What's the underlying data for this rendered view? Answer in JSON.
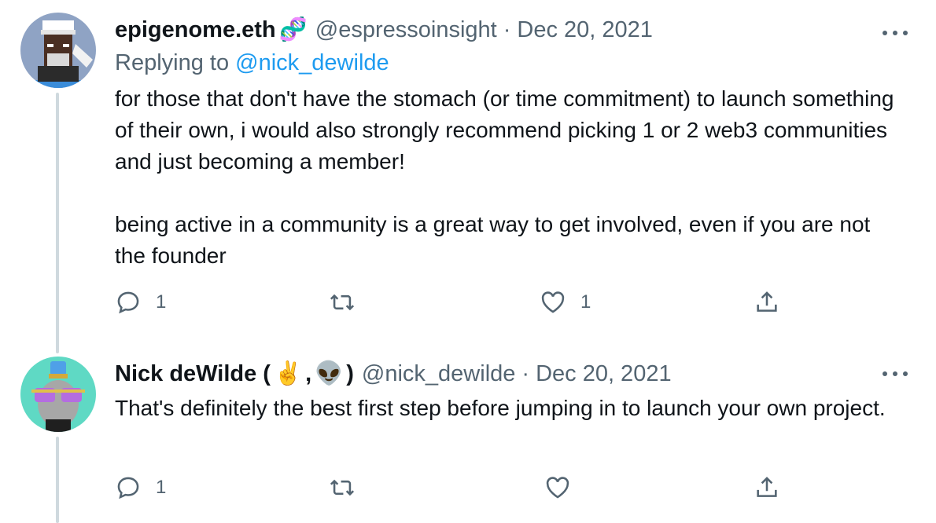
{
  "tweets": [
    {
      "author_name": "epigenome.eth",
      "author_emoji": "🧬",
      "handle": "@espressoinsight",
      "separator": "·",
      "date": "Dec 20, 2021",
      "replying_prefix": "Replying to",
      "replying_mention": "@nick_dewilde",
      "text": "for those that don't have the stomach (or time commitment) to launch something of their own, i would also strongly recommend picking 1 or 2 web3 communities and just becoming a member!\n\nbeing active in a community is a great way to get involved, even if you are not the founder",
      "replies": "1",
      "retweets": "",
      "likes": "1"
    },
    {
      "author_name_prefix": "Nick deWilde (",
      "author_emoji_1": "✌️",
      "author_name_mid": ",",
      "author_emoji_2": "👽",
      "author_name_suffix": ")",
      "handle": "@nick_dewilde",
      "separator": "·",
      "date": "Dec 20, 2021",
      "text": "That's definitely the best first step before jumping in to launch your own project.",
      "replies": "1",
      "retweets": "",
      "likes": ""
    }
  ],
  "colors": {
    "text": "#0f1419",
    "secondary": "#536471",
    "link": "#1d9bf0",
    "thread_line": "#cfd9de"
  },
  "icons": [
    "reply-icon",
    "retweet-icon",
    "like-icon",
    "share-icon",
    "more-icon"
  ]
}
